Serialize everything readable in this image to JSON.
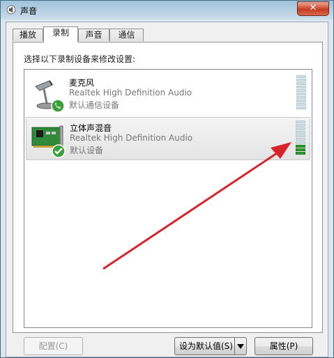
{
  "window": {
    "title": "声音",
    "close_label": "✕"
  },
  "tabs": [
    {
      "label": "播放",
      "active": false
    },
    {
      "label": "录制",
      "active": true
    },
    {
      "label": "声音",
      "active": false
    },
    {
      "label": "通信",
      "active": false
    }
  ],
  "panel": {
    "instruction": "选择以下录制设备来修改设置:"
  },
  "devices": [
    {
      "name": "麦克风",
      "driver": "Realtek High Definition Audio",
      "status": "默认通信设备",
      "icon": "microphone-icon",
      "badge": "phone-badge-icon",
      "level": 0
    },
    {
      "name": "立体声混音",
      "driver": "Realtek High Definition Audio",
      "status": "默认设备",
      "icon": "sound-card-icon",
      "badge": "check-badge-icon",
      "level": 0.33
    }
  ],
  "buttons": {
    "configure": "配置(C)",
    "set_default": "设为默认值(S)",
    "properties": "属性(P)"
  },
  "colors": {
    "annotation_arrow": "#d9232a",
    "meter_on": "#2e9c2e",
    "meter_off": "#cfe0e4"
  }
}
